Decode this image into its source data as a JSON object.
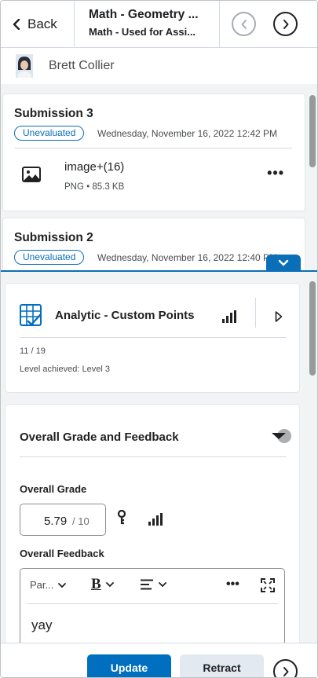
{
  "nav": {
    "back_label": "Back",
    "title": "Math - Geometry ...",
    "subtitle": "Math - Used for Assi..."
  },
  "user": {
    "name": "Brett Collier"
  },
  "submissions": [
    {
      "title": "Submission 3",
      "status": "Unevaluated",
      "date": "Wednesday, November 16, 2022 12:42 PM",
      "file": {
        "name": "image+(16)",
        "type": "PNG",
        "size": "85.3 KB"
      }
    },
    {
      "title": "Submission 2",
      "status": "Unevaluated",
      "date": "Wednesday, November 16, 2022 12:40 PM"
    }
  ],
  "rubric": {
    "title": "Analytic - Custom Points",
    "score": "11 / 19",
    "level": "Level achieved: Level 3"
  },
  "feedback": {
    "section_title": "Overall Grade and Feedback",
    "grade_label": "Overall Grade",
    "grade_value": "5.79",
    "grade_max": "/ 10",
    "feedback_label": "Overall Feedback",
    "toolbar": {
      "paragraph": "Par...",
      "bold": "B"
    },
    "feedback_text": "yay"
  },
  "footer": {
    "update_label": "Update",
    "retract_label": "Retract"
  },
  "colors": {
    "accent": "#006fbf",
    "badge": "#0b6fb7",
    "panel_bg": "#f1f3f5"
  }
}
